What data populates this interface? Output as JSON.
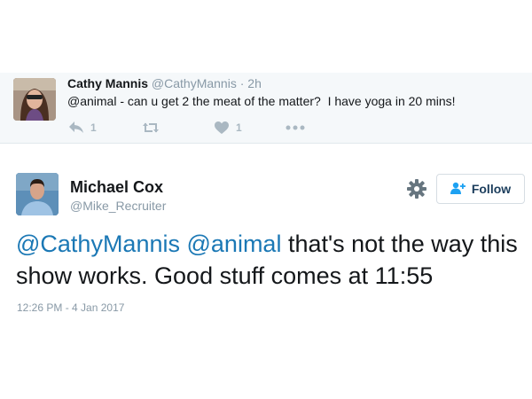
{
  "reply_tweet": {
    "author_name": "Cathy Mannis",
    "author_handle": "@CathyMannis",
    "separator": "·",
    "time_ago": "2h",
    "text_mention": "@animal",
    "text_body": " - can u get 2 the meat of the matter?  I have yoga in 20 mins!",
    "actions": {
      "reply_icon": "reply-icon",
      "reply_count": "1",
      "retweet_icon": "retweet-icon",
      "like_icon": "heart-icon",
      "like_count": "1",
      "more_icon": "more-dots-icon"
    }
  },
  "main_tweet": {
    "author_name": "Michael Cox",
    "author_handle": "@Mike_Recruiter",
    "settings_icon": "gear-icon",
    "follow_icon": "add-user-icon",
    "follow_label": "Follow",
    "text_mention_1": "@CathyMannis",
    "text_mention_2": "@animal",
    "text_body": " that's not the way this show works. Good stuff comes at 11:55",
    "timestamp": "12:26 PM - 4 Jan 2017"
  },
  "colors": {
    "link": "#1b78b5",
    "muted": "#8899a6",
    "action_gray": "#aab8c2",
    "reply_background": "#f5f8fa"
  }
}
